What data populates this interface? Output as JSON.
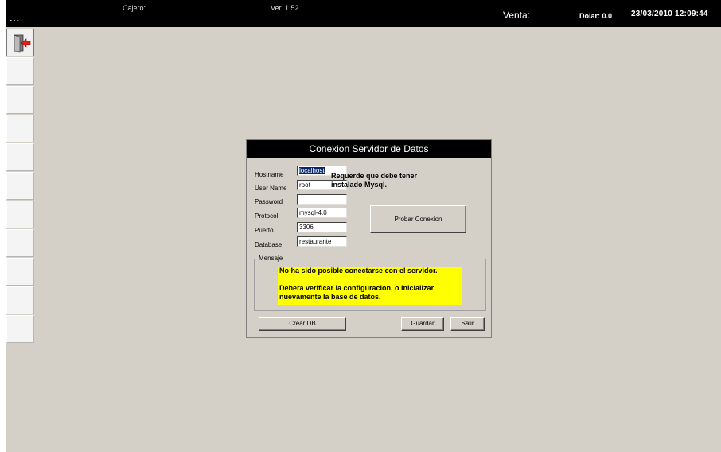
{
  "topbar": {
    "menu_dots": "...",
    "cajero_label": "Cajero:",
    "version": "Ver. 1.52",
    "venta_label": "Venta:",
    "dolar": "Dolar: 0.0",
    "datetime": "23/03/2010 12:09:44"
  },
  "sidebar": {
    "buttons": [
      "exit-icon",
      "",
      "",
      "",
      "",
      "",
      "",
      "",
      "",
      "",
      "",
      ""
    ]
  },
  "dialog": {
    "title": "Conexion Servidor de Datos",
    "fields": {
      "hostname": {
        "label": "Hostname",
        "value": "localhost"
      },
      "username": {
        "label": "User Name",
        "value": "root"
      },
      "password": {
        "label": "Password",
        "value": ""
      },
      "protocol": {
        "label": "Protocol",
        "value": "mysql-4.0"
      },
      "puerto": {
        "label": "Puerto",
        "value": "3306"
      },
      "database": {
        "label": "Database",
        "value": "restaurante"
      }
    },
    "note_line1": "Requerde que debe tener",
    "note_line2": "instalado Mysql.",
    "test_button": "Probar Conexion",
    "group_label": "Mensaje",
    "message_line1": "No ha sido posible conectarse con el servidor.",
    "message_line2": "Debera verificar la configuracion, o inicializar",
    "message_line3": "nuevamente la base de datos.",
    "create_db_button": "Crear DB",
    "save_button": "Guardar",
    "exit_button": "Salir"
  },
  "colors": {
    "background": "#d4d0c8",
    "titlebar": "#000000",
    "message_highlight": "#ffff00",
    "selection": "#0a246a"
  }
}
